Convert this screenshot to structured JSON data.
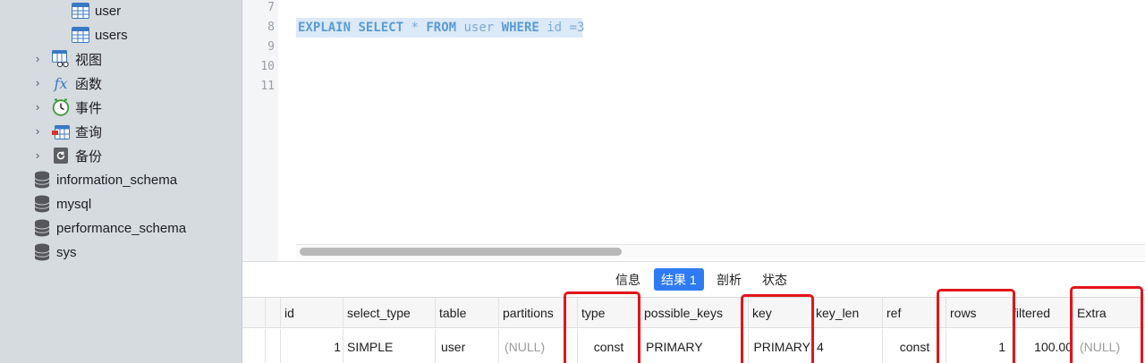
{
  "sidebar": {
    "tables": [
      {
        "label": "user"
      },
      {
        "label": "users"
      }
    ],
    "groups": [
      {
        "label": "视图"
      },
      {
        "label": "函数"
      },
      {
        "label": "事件"
      },
      {
        "label": "查询"
      },
      {
        "label": "备份"
      }
    ],
    "databases": [
      {
        "label": "information_schema"
      },
      {
        "label": "mysql"
      },
      {
        "label": "performance_schema"
      },
      {
        "label": "sys"
      }
    ],
    "function_icon": "fx"
  },
  "editor": {
    "line_numbers": [
      "7",
      "8",
      "9",
      "10",
      "11"
    ],
    "sql": {
      "explain": "EXPLAIN",
      "select": "SELECT",
      "star": "*",
      "from": "FROM",
      "table": "user",
      "where": "WHERE",
      "condition": "id =3"
    }
  },
  "result_tabs": [
    {
      "label": "信息",
      "active": false
    },
    {
      "label": "结果 1",
      "active": true
    },
    {
      "label": "剖析",
      "active": false
    },
    {
      "label": "状态",
      "active": false
    }
  ],
  "result_grid": {
    "columns": [
      "id",
      "select_type",
      "table",
      "partitions",
      "type",
      "possible_keys",
      "key",
      "key_len",
      "ref",
      "rows",
      "filtered",
      "Extra"
    ],
    "row": [
      "1",
      "SIMPLE",
      "user",
      "(NULL)",
      "const",
      "PRIMARY",
      "PRIMARY",
      "4",
      "const",
      "1",
      "100.00",
      "(NULL)"
    ],
    "highlighted_columns": [
      "type",
      "key",
      "rows",
      "Extra"
    ]
  },
  "colors": {
    "accent": "#2f7bf5",
    "highlight_box": "#e3151b",
    "sql_text": "#5b9bd5",
    "sidebar_bg": "#d6dbe0"
  }
}
